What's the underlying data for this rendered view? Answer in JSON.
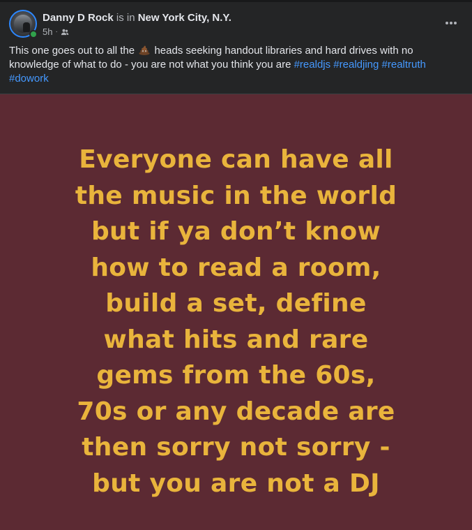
{
  "post": {
    "author": {
      "name": "Danny D Rock",
      "is_in_text": " is in ",
      "place": "New York City, N.Y.",
      "online": true
    },
    "meta": {
      "time": "5h",
      "audience_icon": "friends-icon"
    },
    "more_icon": "more-horizontal-icon",
    "caption": {
      "before_emoji": "This one goes out to all the ",
      "emoji": "poop-emoji",
      "after_emoji": " heads seeking handout libraries and hard drives with no knowledge of what to do - you are not what you think you are ",
      "hashtags": [
        "#realdjs",
        "#realdjing",
        "#realtruth",
        "#dowork"
      ]
    },
    "image": {
      "background_color": "#5c2a33",
      "text_color": "#e9b43c",
      "lines": [
        "Everyone can have all",
        "the music in the world",
        "but if ya don’t know",
        "how to read a room,",
        "build a set, define",
        "what hits and rare",
        "gems from the 60s,",
        "70s or any decade are",
        "then sorry not sorry -",
        "but you are not a DJ"
      ]
    }
  }
}
